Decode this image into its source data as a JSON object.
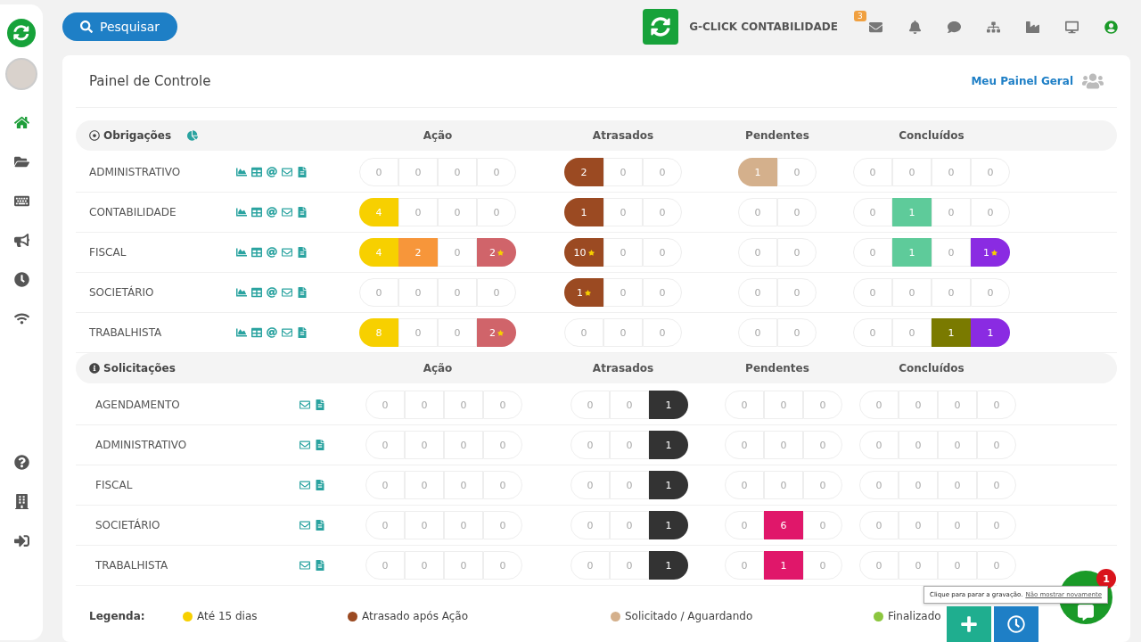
{
  "topbar": {
    "search_button": "Pesquisar",
    "company": "G-CLICK CONTABILIDADE",
    "mail_badge": "3"
  },
  "sidebar": {
    "nav": [
      {
        "selected": true
      },
      {
        "selected": false
      },
      {
        "selected": false
      },
      {
        "selected": false
      },
      {
        "selected": false
      },
      {
        "selected": false
      }
    ]
  },
  "panel": {
    "title": "Painel de Controle",
    "link": "Meu Painel Geral"
  },
  "sections": [
    {
      "kind": "obligations",
      "title": "Obrigações",
      "headers": [
        "Ação",
        "Atrasados",
        "Pendentes",
        "Concluídos"
      ],
      "rows": [
        {
          "name": "ADMINISTRATIVO",
          "groups": [
            [
              {
                "value": "0",
                "flagged": false
              },
              {
                "value": "0",
                "flagged": false
              },
              {
                "value": "0",
                "flagged": false
              },
              {
                "value": "0",
                "flagged": false
              }
            ],
            [
              {
                "value": "2",
                "flagged": false,
                "color": "#9b4a22"
              },
              {
                "value": "0",
                "flagged": false
              },
              {
                "value": "0",
                "flagged": false
              }
            ],
            [
              {
                "value": "1",
                "flagged": false,
                "color": "#d4b08c"
              },
              {
                "value": "0",
                "flagged": false
              }
            ],
            [
              {
                "value": "0",
                "flagged": false
              },
              {
                "value": "0",
                "flagged": false
              },
              {
                "value": "0",
                "flagged": false
              },
              {
                "value": "0",
                "flagged": false
              }
            ]
          ]
        },
        {
          "name": "CONTABILIDADE",
          "groups": [
            [
              {
                "value": "4",
                "flagged": false,
                "color": "#f7d000"
              },
              {
                "value": "0",
                "flagged": false
              },
              {
                "value": "0",
                "flagged": false
              },
              {
                "value": "0",
                "flagged": false
              }
            ],
            [
              {
                "value": "1",
                "flagged": false,
                "color": "#9b4a22"
              },
              {
                "value": "0",
                "flagged": false
              },
              {
                "value": "0",
                "flagged": false
              }
            ],
            [
              {
                "value": "0",
                "flagged": false
              },
              {
                "value": "0",
                "flagged": false
              }
            ],
            [
              {
                "value": "0",
                "flagged": false
              },
              {
                "value": "1",
                "flagged": false,
                "color": "#5ecb9a"
              },
              {
                "value": "0",
                "flagged": false
              },
              {
                "value": "0",
                "flagged": false
              }
            ]
          ]
        },
        {
          "name": "FISCAL",
          "groups": [
            [
              {
                "value": "4",
                "flagged": false,
                "color": "#f7d000"
              },
              {
                "value": "2",
                "flagged": false,
                "color": "#f7963a"
              },
              {
                "value": "0",
                "flagged": false
              },
              {
                "value": "2",
                "flagged": true,
                "color": "#d0646a"
              }
            ],
            [
              {
                "value": "10",
                "flagged": true,
                "color": "#9b4a22"
              },
              {
                "value": "0",
                "flagged": false
              },
              {
                "value": "0",
                "flagged": false
              }
            ],
            [
              {
                "value": "0",
                "flagged": false
              },
              {
                "value": "0",
                "flagged": false
              }
            ],
            [
              {
                "value": "0",
                "flagged": false
              },
              {
                "value": "1",
                "flagged": false,
                "color": "#5ecb9a"
              },
              {
                "value": "0",
                "flagged": false
              },
              {
                "value": "1",
                "flagged": true,
                "color": "#8a2be2"
              }
            ]
          ]
        },
        {
          "name": "SOCIETÁRIO",
          "groups": [
            [
              {
                "value": "0",
                "flagged": false
              },
              {
                "value": "0",
                "flagged": false
              },
              {
                "value": "0",
                "flagged": false
              },
              {
                "value": "0",
                "flagged": false
              }
            ],
            [
              {
                "value": "1",
                "flagged": true,
                "color": "#9b4a22"
              },
              {
                "value": "0",
                "flagged": false
              },
              {
                "value": "0",
                "flagged": false
              }
            ],
            [
              {
                "value": "0",
                "flagged": false
              },
              {
                "value": "0",
                "flagged": false
              }
            ],
            [
              {
                "value": "0",
                "flagged": false
              },
              {
                "value": "0",
                "flagged": false
              },
              {
                "value": "0",
                "flagged": false
              },
              {
                "value": "0",
                "flagged": false
              }
            ]
          ]
        },
        {
          "name": "TRABALHISTA",
          "groups": [
            [
              {
                "value": "8",
                "flagged": false,
                "color": "#f7d000"
              },
              {
                "value": "0",
                "flagged": false
              },
              {
                "value": "0",
                "flagged": false
              },
              {
                "value": "2",
                "flagged": true,
                "color": "#d0646a"
              }
            ],
            [
              {
                "value": "0",
                "flagged": false
              },
              {
                "value": "0",
                "flagged": false
              },
              {
                "value": "0",
                "flagged": false
              }
            ],
            [
              {
                "value": "0",
                "flagged": false
              },
              {
                "value": "0",
                "flagged": false
              }
            ],
            [
              {
                "value": "0",
                "flagged": false
              },
              {
                "value": "0",
                "flagged": false
              },
              {
                "value": "1",
                "flagged": false,
                "color": "#7a7a00"
              },
              {
                "value": "1",
                "flagged": false,
                "color": "#8a2be2"
              }
            ]
          ]
        }
      ]
    },
    {
      "kind": "requests",
      "title": "Solicitações",
      "headers": [
        "Ação",
        "Atrasados",
        "Pendentes",
        "Concluídos"
      ],
      "rows": [
        {
          "name": "AGENDAMENTO",
          "groups": [
            [
              {
                "value": "0",
                "flagged": false
              },
              {
                "value": "0",
                "flagged": false
              },
              {
                "value": "0",
                "flagged": false
              },
              {
                "value": "0",
                "flagged": false
              }
            ],
            [
              {
                "value": "0",
                "flagged": false
              },
              {
                "value": "0",
                "flagged": false
              },
              {
                "value": "1",
                "flagged": false,
                "color": "#333333"
              }
            ],
            [
              {
                "value": "0",
                "flagged": false
              },
              {
                "value": "0",
                "flagged": false
              },
              {
                "value": "0",
                "flagged": false
              }
            ],
            [
              {
                "value": "0",
                "flagged": false
              },
              {
                "value": "0",
                "flagged": false
              },
              {
                "value": "0",
                "flagged": false
              },
              {
                "value": "0",
                "flagged": false
              }
            ]
          ]
        },
        {
          "name": "ADMINISTRATIVO",
          "groups": [
            [
              {
                "value": "0",
                "flagged": false
              },
              {
                "value": "0",
                "flagged": false
              },
              {
                "value": "0",
                "flagged": false
              },
              {
                "value": "0",
                "flagged": false
              }
            ],
            [
              {
                "value": "0",
                "flagged": false
              },
              {
                "value": "0",
                "flagged": false
              },
              {
                "value": "1",
                "flagged": false,
                "color": "#333333"
              }
            ],
            [
              {
                "value": "0",
                "flagged": false
              },
              {
                "value": "0",
                "flagged": false
              },
              {
                "value": "0",
                "flagged": false
              }
            ],
            [
              {
                "value": "0",
                "flagged": false
              },
              {
                "value": "0",
                "flagged": false
              },
              {
                "value": "0",
                "flagged": false
              },
              {
                "value": "0",
                "flagged": false
              }
            ]
          ]
        },
        {
          "name": "FISCAL",
          "groups": [
            [
              {
                "value": "0",
                "flagged": false
              },
              {
                "value": "0",
                "flagged": false
              },
              {
                "value": "0",
                "flagged": false
              },
              {
                "value": "0",
                "flagged": false
              }
            ],
            [
              {
                "value": "0",
                "flagged": false
              },
              {
                "value": "0",
                "flagged": false
              },
              {
                "value": "1",
                "flagged": false,
                "color": "#333333"
              }
            ],
            [
              {
                "value": "0",
                "flagged": false
              },
              {
                "value": "0",
                "flagged": false
              },
              {
                "value": "0",
                "flagged": false
              }
            ],
            [
              {
                "value": "0",
                "flagged": false
              },
              {
                "value": "0",
                "flagged": false
              },
              {
                "value": "0",
                "flagged": false
              },
              {
                "value": "0",
                "flagged": false
              }
            ]
          ]
        },
        {
          "name": "SOCIETÁRIO",
          "groups": [
            [
              {
                "value": "0",
                "flagged": false
              },
              {
                "value": "0",
                "flagged": false
              },
              {
                "value": "0",
                "flagged": false
              },
              {
                "value": "0",
                "flagged": false
              }
            ],
            [
              {
                "value": "0",
                "flagged": false
              },
              {
                "value": "0",
                "flagged": false
              },
              {
                "value": "1",
                "flagged": false,
                "color": "#333333"
              }
            ],
            [
              {
                "value": "0",
                "flagged": false
              },
              {
                "value": "6",
                "flagged": false,
                "color": "#e0176a"
              },
              {
                "value": "0",
                "flagged": false
              }
            ],
            [
              {
                "value": "0",
                "flagged": false
              },
              {
                "value": "0",
                "flagged": false
              },
              {
                "value": "0",
                "flagged": false
              },
              {
                "value": "0",
                "flagged": false
              }
            ]
          ]
        },
        {
          "name": "TRABALHISTA",
          "groups": [
            [
              {
                "value": "0",
                "flagged": false
              },
              {
                "value": "0",
                "flagged": false
              },
              {
                "value": "0",
                "flagged": false
              },
              {
                "value": "0",
                "flagged": false
              }
            ],
            [
              {
                "value": "0",
                "flagged": false
              },
              {
                "value": "0",
                "flagged": false
              },
              {
                "value": "1",
                "flagged": false,
                "color": "#333333"
              }
            ],
            [
              {
                "value": "0",
                "flagged": false
              },
              {
                "value": "1",
                "flagged": false,
                "color": "#e0176a"
              },
              {
                "value": "0",
                "flagged": false
              }
            ],
            [
              {
                "value": "0",
                "flagged": false
              },
              {
                "value": "0",
                "flagged": false
              },
              {
                "value": "0",
                "flagged": false
              },
              {
                "value": "0",
                "flagged": false
              }
            ]
          ]
        }
      ]
    }
  ],
  "legend": {
    "label": "Legenda:",
    "items": [
      {
        "text": "Até 15 dias",
        "color": "#f7d000"
      },
      {
        "text": "Atrasado após Ação",
        "color": "#9b4a22"
      },
      {
        "text": "Solicitado / Aguardando",
        "color": "#d4b08c"
      },
      {
        "text": "Finalizado",
        "color": "#8cc63f"
      }
    ]
  },
  "recording": {
    "tooltip": "Clique para parar a gravação.",
    "link": "Não mostrar novamente"
  },
  "chat": {
    "badge": "1"
  }
}
